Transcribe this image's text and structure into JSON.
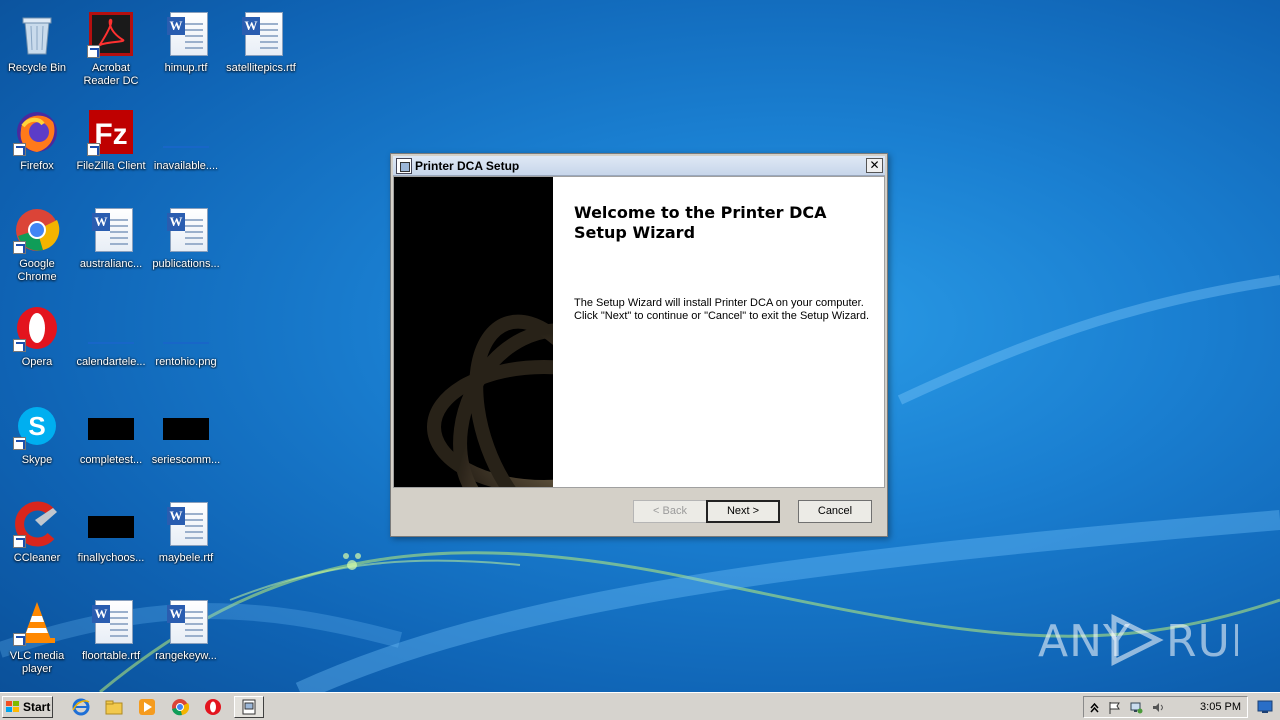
{
  "desktop": {
    "icons": [
      {
        "label": "Recycle Bin"
      },
      {
        "label": "Acrobat Reader DC"
      },
      {
        "label": "himup.rtf"
      },
      {
        "label": "satellitepics.rtf"
      },
      {
        "label": "Firefox"
      },
      {
        "label": "FileZilla Client"
      },
      {
        "label": "inavailable...."
      },
      {
        "label": "Google Chrome"
      },
      {
        "label": "australianc..."
      },
      {
        "label": "publications..."
      },
      {
        "label": "Opera"
      },
      {
        "label": "calendartele..."
      },
      {
        "label": "rentohio.png"
      },
      {
        "label": "Skype"
      },
      {
        "label": "completest..."
      },
      {
        "label": "seriescomm..."
      },
      {
        "label": "CCleaner"
      },
      {
        "label": "finallychoos..."
      },
      {
        "label": "maybele.rtf"
      },
      {
        "label": "VLC media player"
      },
      {
        "label": "floortable.rtf"
      },
      {
        "label": "rangekeyw..."
      }
    ]
  },
  "dialog": {
    "title": "Printer DCA Setup",
    "close_label": "✕",
    "heading": "Welcome to the Printer DCA Setup Wizard",
    "description_line1": "The Setup Wizard will install Printer DCA on your computer.",
    "description_line2": "Click \"Next\" to continue or \"Cancel\" to exit the Setup Wizard.",
    "back_label": "< Back",
    "next_label": "Next >",
    "cancel_label": "Cancel"
  },
  "taskbar": {
    "start_label": "Start",
    "clock": "3:05 PM"
  },
  "watermark": "ANY RUN",
  "colors": {
    "desktop_bg": "#1a7fd1",
    "dialog_bg": "#d4d0c8",
    "taskbar_bg": "#d6d3ce"
  }
}
